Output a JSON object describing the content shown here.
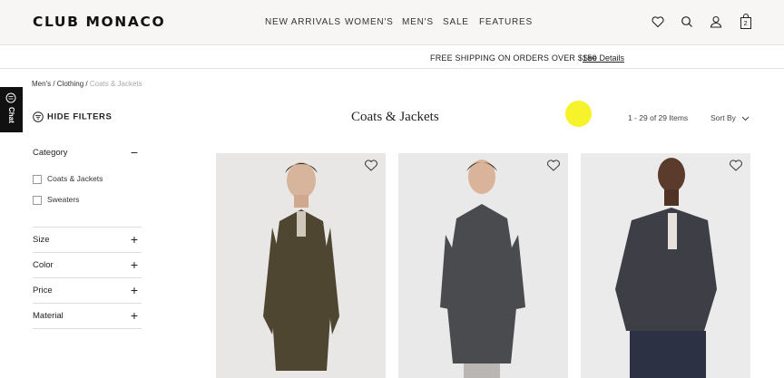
{
  "header": {
    "logo": "CLUB MONACO",
    "nav": [
      "NEW ARRIVALS",
      "WOMEN'S",
      "MEN'S",
      "SALE",
      "FEATURES"
    ],
    "bag_count": "2"
  },
  "promo": {
    "text": "FREE SHIPPING ON ORDERS OVER $150",
    "link": "See Details"
  },
  "breadcrumb": {
    "items": [
      "Men's",
      "Clothing"
    ],
    "separator": "/",
    "current": "Coats & Jackets"
  },
  "chat": {
    "label": "Chat"
  },
  "filters": {
    "toggle_label": "HIDE FILTERS",
    "category": {
      "label": "Category",
      "sign": "−",
      "options": [
        "Coats & Jackets",
        "Sweaters"
      ]
    },
    "collapsed": [
      {
        "label": "Size",
        "sign": "+"
      },
      {
        "label": "Color",
        "sign": "+"
      },
      {
        "label": "Price",
        "sign": "+"
      },
      {
        "label": "Material",
        "sign": "+"
      }
    ]
  },
  "listing": {
    "title": "Coats & Jackets",
    "count": "1 - 29 of 29 Items",
    "sort_label": "Sort By"
  },
  "products": [
    {
      "coat_color": "#4f4632",
      "bg": "#e8e7e5"
    },
    {
      "coat_color": "#4a4b4f",
      "bg": "#e9e9ea"
    },
    {
      "coat_color": "#3e3e46",
      "bg": "#ebebeb"
    }
  ],
  "colors": {
    "header_bg": "#f7f6f4",
    "cursor_highlight": "#f7f32a",
    "chat_bg": "#111111"
  }
}
